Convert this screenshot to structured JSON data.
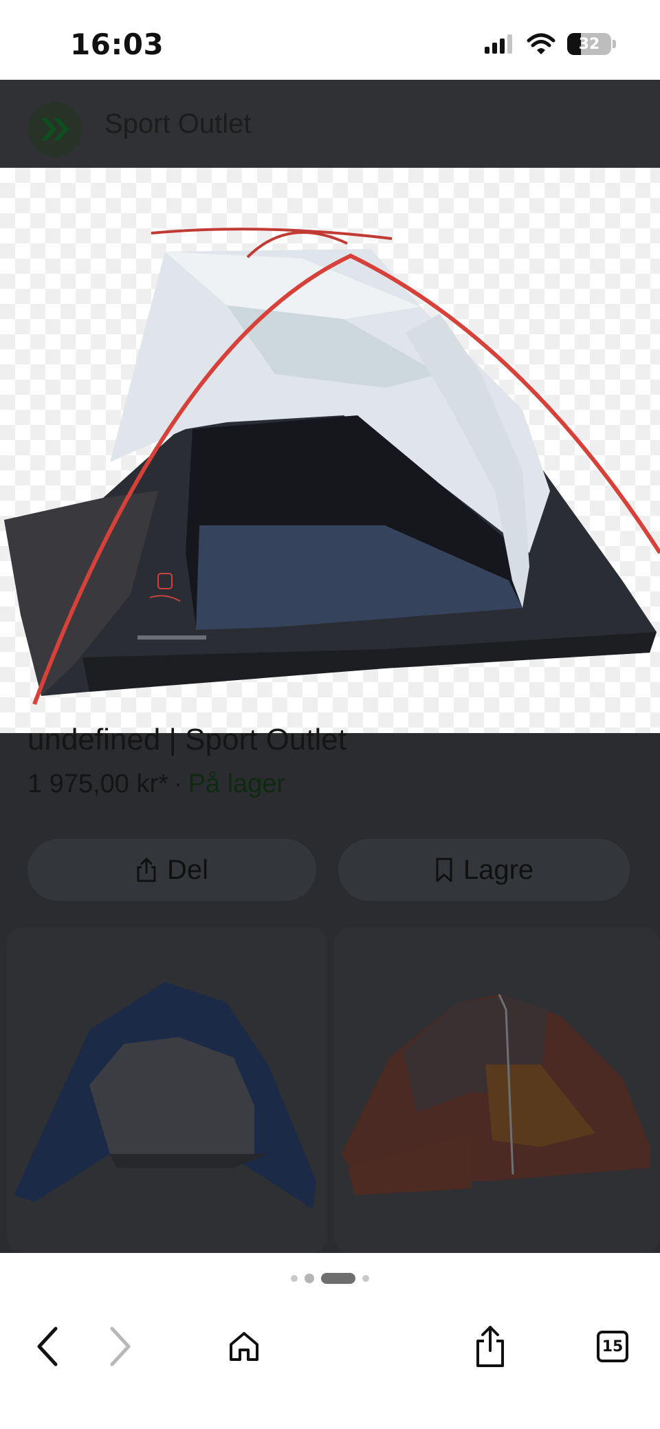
{
  "status_bar": {
    "time": "16:03",
    "battery": "32",
    "battery_level": 0.32
  },
  "header": {
    "site_name": "Sport Outlet"
  },
  "product": {
    "title": "undefined | Sport Outlet",
    "price": "1 975,00 kr*",
    "separator": "·",
    "availability": "På lager"
  },
  "actions": {
    "share_label": "Del",
    "save_label": "Lagre"
  },
  "thumbnails": [
    {
      "description": "blue-tent"
    },
    {
      "description": "red-tent"
    }
  ],
  "pager": {
    "count": 4,
    "active_index": 2
  },
  "toolbar": {
    "tabs_count": "15"
  },
  "colors": {
    "dim_background": "#2b2c2f",
    "button_background": "#33363b",
    "availability": "#0e2a10"
  }
}
